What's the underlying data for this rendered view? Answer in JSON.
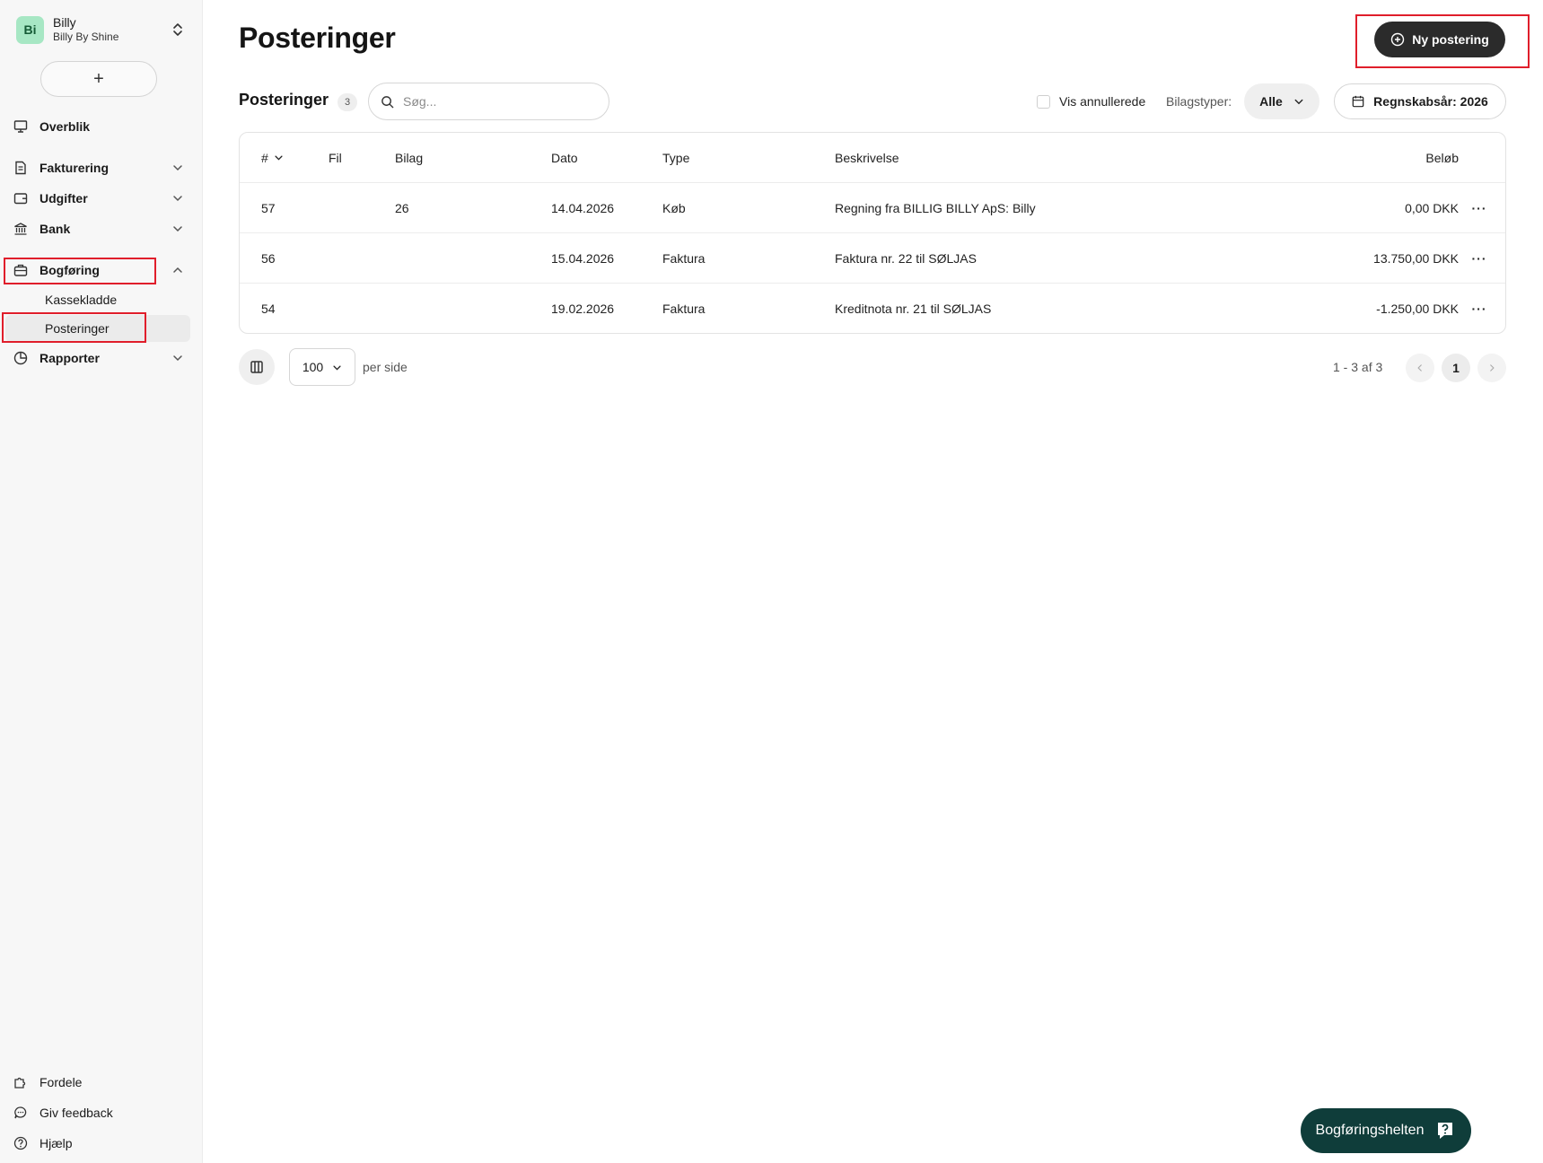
{
  "org": {
    "initials": "Bi",
    "name": "Billy",
    "subtitle": "Billy By Shine"
  },
  "sidebar": {
    "add_label": "+",
    "items": [
      {
        "label": "Overblik",
        "icon": "monitor-icon"
      },
      {
        "label": "Fakturering",
        "icon": "document-icon"
      },
      {
        "label": "Udgifter",
        "icon": "wallet-icon"
      },
      {
        "label": "Bank",
        "icon": "bank-icon"
      },
      {
        "label": "Bogføring",
        "icon": "briefcase-icon"
      },
      {
        "label": "Rapporter",
        "icon": "pie-chart-icon"
      }
    ],
    "subitems": [
      {
        "label": "Kassekladde"
      },
      {
        "label": "Posteringer"
      }
    ],
    "bottom": [
      {
        "label": "Fordele",
        "icon": "puzzle-icon"
      },
      {
        "label": "Giv feedback",
        "icon": "chat-icon"
      },
      {
        "label": "Hjælp",
        "icon": "help-icon"
      }
    ]
  },
  "page": {
    "title": "Posteringer",
    "new_button": "Ny postering"
  },
  "toolbar": {
    "title": "Posteringer",
    "count": "3",
    "search_placeholder": "Søg...",
    "show_cancelled": "Vis annullerede",
    "voucher_types_label": "Bilagstyper:",
    "voucher_types_value": "Alle",
    "fiscal_year": "Regnskabsår: 2026"
  },
  "table": {
    "headers": {
      "num": "#",
      "fil": "Fil",
      "bilag": "Bilag",
      "dato": "Dato",
      "type": "Type",
      "desc": "Beskrivelse",
      "amount": "Beløb"
    },
    "rows": [
      {
        "num": "57",
        "fil": "",
        "bilag": "26",
        "dato": "14.04.2026",
        "type": "Køb",
        "desc": "Regning fra BILLIG BILLY ApS: Billy",
        "amount": "0,00 DKK"
      },
      {
        "num": "56",
        "fil": "",
        "bilag": "",
        "dato": "15.04.2026",
        "type": "Faktura",
        "desc": "Faktura nr. 22 til SØLJAS",
        "amount": "13.750,00 DKK"
      },
      {
        "num": "54",
        "fil": "",
        "bilag": "",
        "dato": "19.02.2026",
        "type": "Faktura",
        "desc": "Kreditnota nr. 21 til SØLJAS",
        "amount": "-1.250,00 DKK"
      }
    ]
  },
  "pagination": {
    "per_page": "100",
    "per_side": "per side",
    "range": "1 - 3 af 3",
    "current": "1"
  },
  "help_widget": {
    "label": "Bogføringshelten"
  },
  "colors": {
    "accent_dark": "#2b2b2b",
    "highlight": "#e01e2b",
    "help_bg": "#0f3d3a",
    "avatar_bg": "#a7e7c4"
  }
}
